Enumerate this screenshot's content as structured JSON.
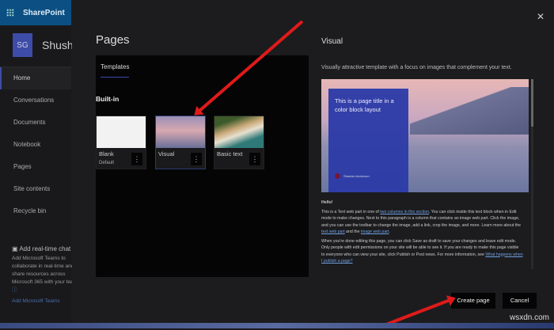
{
  "app": {
    "name": "SharePoint",
    "site_initials": "SG",
    "site_name": "Shush-"
  },
  "nav": [
    "Home",
    "Conversations",
    "Documents",
    "Notebook",
    "Pages",
    "Site contents",
    "Recycle bin"
  ],
  "chat": {
    "title": "Add real-time chat",
    "lines": [
      "Add Microsoft Teams to",
      "collaborate in real-time and",
      "share resources across",
      "Microsoft 365 with your team"
    ],
    "link": "Add Microsoft Teams"
  },
  "dialog": {
    "title": "Pages",
    "tab": "Templates",
    "section": "Built-in",
    "templates": [
      {
        "name": "Blank",
        "sub": "Default"
      },
      {
        "name": "Visual",
        "sub": ""
      },
      {
        "name": "Basic text",
        "sub": ""
      }
    ],
    "preview_title": "Visual",
    "preview_desc": "Visually attractive template with a focus on images that complement your text.",
    "block_title": "This is a page title in a color block layout",
    "author": "Shanlan Anderson",
    "author_initials": "SA",
    "hello": "Hello!",
    "p1a": "This is a Text web part in one of ",
    "p1link": "two columns in this section",
    "p1b": ". You can click inside this text block when in Edit mode to make changes. Next to this paragraph is a column that contains an image web part. Click the image, and you can use the toolbar to change the image, add a link, crop the image, and more. Learn more about the ",
    "p1link2": "text web part",
    "p1c": " and the ",
    "p1link3": "image web part",
    "p1d": ".",
    "p2": "When you're done editing this page, you can click Save as draft to save your changes and leave edit mode. Only people with edit permissions on your site will be able to see it. If you are ready to make this page visible to everyone who can view your site, click Publish or Post news. For more information, see ",
    "p2link": "What happens when I publish a page?",
    "create": "Create page",
    "cancel": "Cancel",
    "close": "✕"
  },
  "watermark": "wsxdn.com"
}
